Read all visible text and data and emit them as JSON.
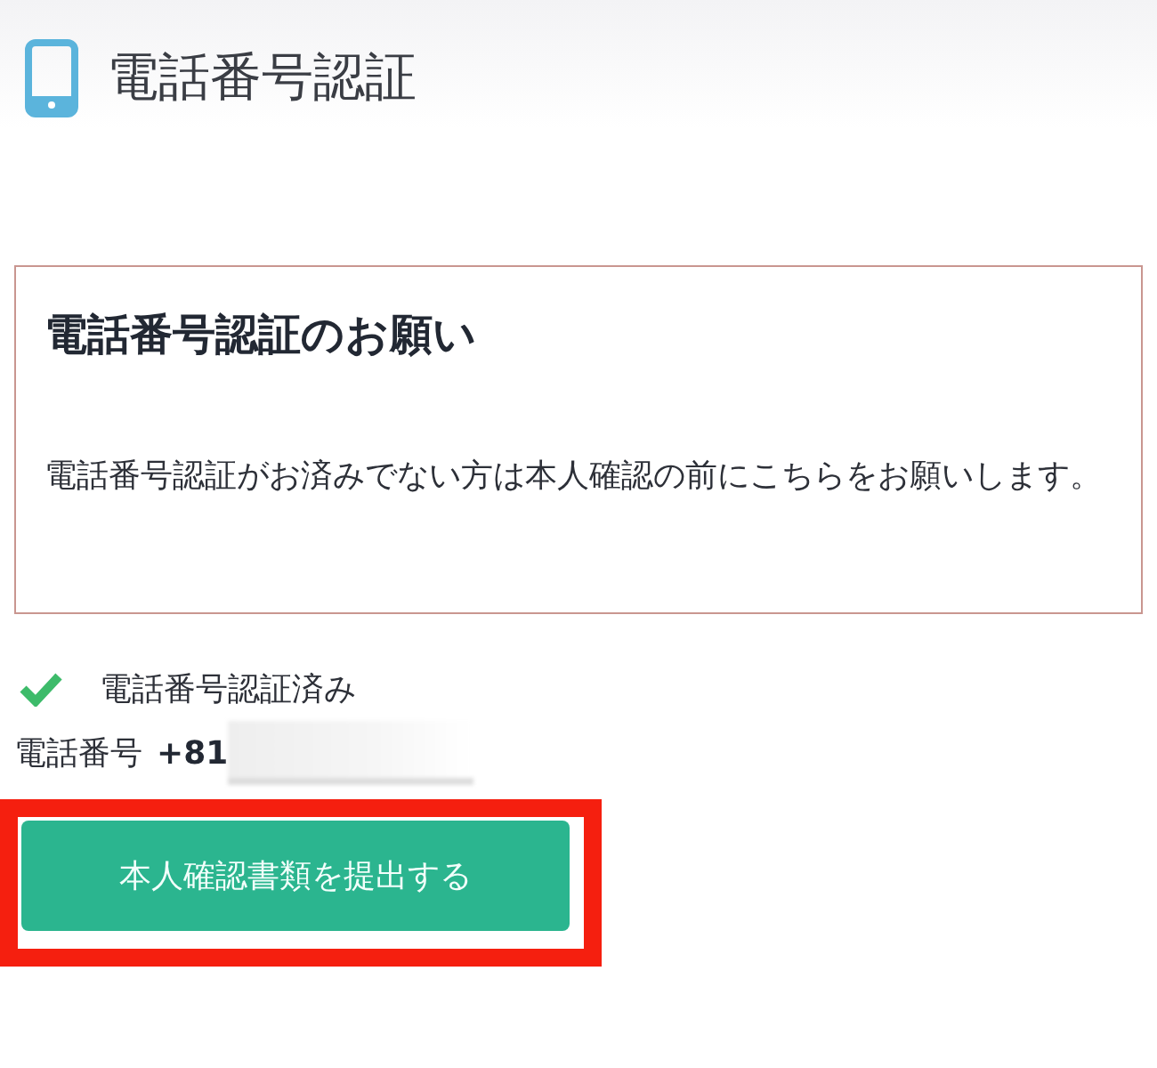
{
  "header": {
    "title": "電話番号認証"
  },
  "notice": {
    "heading": "電話番号認証のお願い",
    "body": "電話番号認証がお済みでない方は本人確認の前にこちらをお願いします。"
  },
  "status": {
    "verified": true,
    "label": "電話番号認証済み"
  },
  "phone": {
    "label": "電話番号",
    "value": "+81",
    "redacted": true
  },
  "submit_button": {
    "label": "本人確認書類を提出する",
    "highlighted": true
  }
}
